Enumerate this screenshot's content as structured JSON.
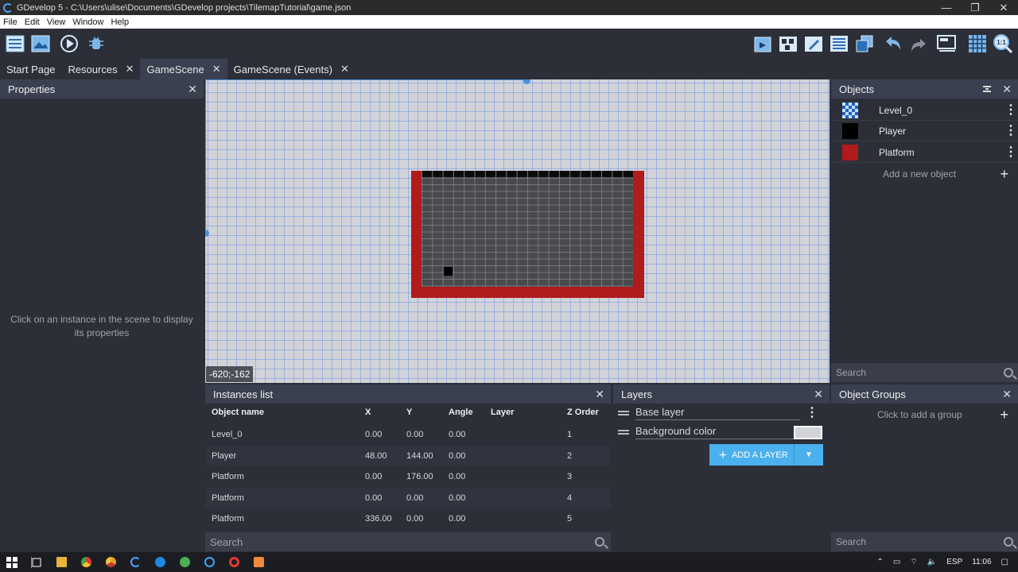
{
  "window": {
    "title": "GDevelop 5 - C:\\Users\\ulise\\Documents\\GDevelop projects\\TilemapTutorial\\game.json",
    "minimize": "—",
    "maximize": "❐",
    "close": "✕"
  },
  "menu": [
    "File",
    "Edit",
    "View",
    "Window",
    "Help"
  ],
  "toolbar": {
    "left": [
      "project-manager-icon",
      "scene-icon",
      "preview-icon",
      "debug-icon"
    ],
    "right": [
      "add-instance-icon",
      "object-groups-icon",
      "edit-icon",
      "instances-list-icon",
      "layers-icon",
      "undo-icon",
      "redo-icon",
      "editor-settings-icon",
      "grid-icon",
      "zoom-reset-icon"
    ],
    "zoom_label": "1:1"
  },
  "tabs": [
    {
      "label": "Start Page",
      "closable": false
    },
    {
      "label": "Resources",
      "closable": true
    },
    {
      "label": "GameScene",
      "closable": true,
      "active": true
    },
    {
      "label": "GameScene (Events)",
      "closable": true
    }
  ],
  "properties": {
    "title": "Properties",
    "empty_text": "Click on an instance in the scene to display its properties"
  },
  "scene": {
    "coords": "-620;-162"
  },
  "objects": {
    "title": "Objects",
    "items": [
      {
        "name": "Level_0",
        "icon": "tilemap-icon"
      },
      {
        "name": "Player",
        "icon": "player-sprite-icon"
      },
      {
        "name": "Platform",
        "icon": "platform-sprite-icon"
      }
    ],
    "add_label": "Add a new object",
    "search_placeholder": "Search"
  },
  "instances": {
    "title": "Instances list",
    "columns": [
      "Object name",
      "X",
      "Y",
      "Angle",
      "Layer",
      "Z Order"
    ],
    "rows": [
      {
        "name": "Level_0",
        "x": "0.00",
        "y": "0.00",
        "angle": "0.00",
        "layer": "",
        "z": "1"
      },
      {
        "name": "Player",
        "x": "48.00",
        "y": "144.00",
        "angle": "0.00",
        "layer": "",
        "z": "2"
      },
      {
        "name": "Platform",
        "x": "0.00",
        "y": "176.00",
        "angle": "0.00",
        "layer": "",
        "z": "3"
      },
      {
        "name": "Platform",
        "x": "0.00",
        "y": "0.00",
        "angle": "0.00",
        "layer": "",
        "z": "4"
      },
      {
        "name": "Platform",
        "x": "336.00",
        "y": "0.00",
        "angle": "0.00",
        "layer": "",
        "z": "5"
      }
    ],
    "search_placeholder": "Search"
  },
  "layers": {
    "title": "Layers",
    "items": [
      "Base layer",
      "Background color"
    ],
    "add_label": "ADD A LAYER"
  },
  "groups": {
    "title": "Object Groups",
    "hint": "Click to add a group",
    "search_placeholder": "Search"
  },
  "taskbar": {
    "apps": [
      "start-icon",
      "task-view-icon",
      "file-explorer-icon",
      "chrome-icon",
      "chrome-canary-icon",
      "gdevelop-icon",
      "edge-icon",
      "app-green-icon",
      "app-blue-icon",
      "opera-icon",
      "app-orange-icon"
    ],
    "lang": "ESP",
    "time": "11:06"
  }
}
